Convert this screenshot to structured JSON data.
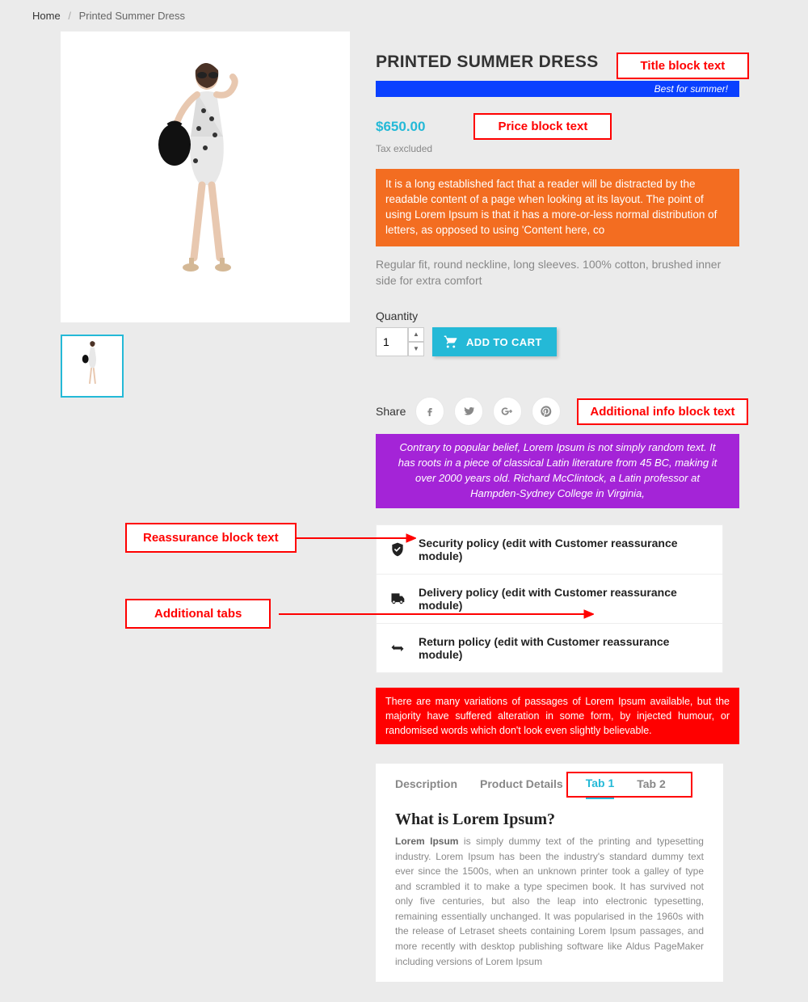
{
  "breadcrumb": {
    "home": "Home",
    "current": "Printed Summer Dress"
  },
  "labels": {
    "title_block": "Title block text",
    "price_block": "Price block text",
    "addl_info_block": "Additional info block text",
    "reassurance_block": "Reassurance block text",
    "addl_tabs": "Additional tabs"
  },
  "product": {
    "title": "PRINTED SUMMER DRESS",
    "tagline": "Best for summer!",
    "price": "$650.00",
    "tax_note": "Tax excluded",
    "orange_text": "It is a long established fact that a reader will be distracted by the readable content of a page when looking at its layout. The point of using Lorem Ipsum is that it has a more-or-less normal distribution of letters, as opposed to using 'Content here, co",
    "short_desc": "Regular fit, round neckline, long sleeves. 100% cotton, brushed inner side for extra comfort",
    "qty_label": "Quantity",
    "qty_value": "1",
    "add_to_cart": "ADD TO CART",
    "share_label": "Share",
    "purple_text": "Contrary to popular belief, Lorem Ipsum is not simply random text. It has roots in a piece of classical Latin literature from 45 BC, making it over 2000 years old. Richard McClintock, a Latin professor at Hampden-Sydney College in Virginia,",
    "red_text": "There are many variations of passages of Lorem Ipsum available, but the majority have suffered alteration in some form, by injected humour, or randomised words which don't look even slightly believable."
  },
  "reassurance": [
    "Security policy (edit with Customer reassurance module)",
    "Delivery policy (edit with Customer reassurance module)",
    "Return policy (edit with Customer reassurance module)"
  ],
  "tabs": {
    "list": [
      "Description",
      "Product Details",
      "Tab 1",
      "Tab 2"
    ],
    "active_index": 2,
    "heading": "What is Lorem Ipsum?",
    "body_bold": "Lorem Ipsum",
    "body": " is simply dummy text of the printing and typesetting industry. Lorem Ipsum has been the industry's standard dummy text ever since the 1500s, when an unknown printer took a galley of type and scrambled it to make a type specimen book. It has survived not only five centuries, but also the leap into electronic typesetting, remaining essentially unchanged. It was popularised in the 1960s with the release of Letraset sheets containing Lorem Ipsum passages, and more recently with desktop publishing software like Aldus PageMaker including versions of Lorem Ipsum"
  }
}
